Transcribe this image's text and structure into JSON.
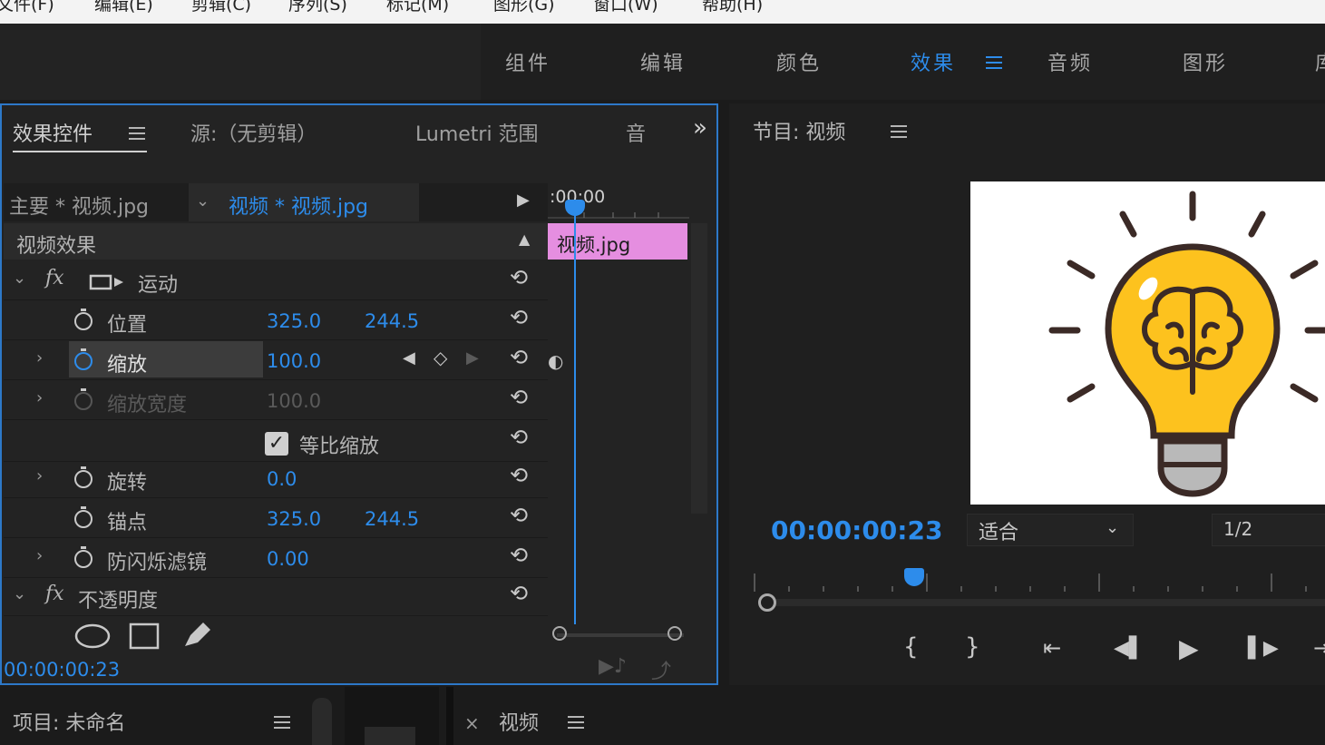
{
  "menu": [
    "文件(F)",
    "编辑(E)",
    "剪辑(C)",
    "序列(S)",
    "标记(M)",
    "图形(G)",
    "窗口(W)",
    "帮助(H)"
  ],
  "workspaces": {
    "items": [
      "组件",
      "编辑",
      "颜色",
      "效果",
      "音频",
      "图形",
      "库"
    ],
    "active": "效果"
  },
  "effect_controls": {
    "tabs": [
      "效果控件",
      "源:（无剪辑）",
      "Lumetri 范围",
      "音"
    ],
    "overflow": "»",
    "clip_master": "主要 * 视频.jpg",
    "clip_sequence": "视频 * 视频.jpg",
    "timeline_time": ":00:00",
    "clip_bar_label": "视频.jpg",
    "section_title": "视频效果",
    "fx_motion": "运动",
    "fx_symbol": "fx",
    "props": {
      "position": {
        "label": "位置",
        "x": "325.0",
        "y": "244.5"
      },
      "scale": {
        "label": "缩放",
        "value": "100.0"
      },
      "scale_width": {
        "label": "缩放宽度",
        "value": "100.0"
      },
      "uniform_scale": {
        "label": "等比缩放",
        "checked": true
      },
      "rotation": {
        "label": "旋转",
        "value": "0.0"
      },
      "anchor": {
        "label": "锚点",
        "x": "325.0",
        "y": "244.5"
      },
      "antiflicker": {
        "label": "防闪烁滤镜",
        "value": "0.00"
      }
    },
    "fx_opacity": "不透明度",
    "timecode": "00:00:00:23"
  },
  "program": {
    "title": "节目: 视频",
    "timecode": "00:00:00:23",
    "fit": "适合",
    "resolution": "1/2"
  },
  "bottom": {
    "project": "项目: 未命名",
    "sequence_tab": "视频",
    "close": "×"
  },
  "colors": {
    "accent": "#2d8ceb",
    "clip_pink": "#e58ee0",
    "bulb_yellow": "#fdc21e"
  }
}
